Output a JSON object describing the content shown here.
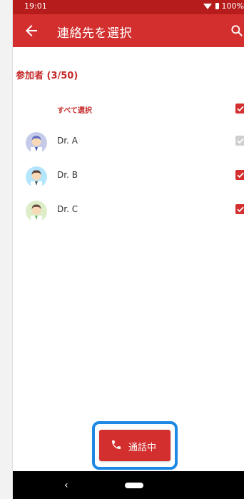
{
  "status_bar": {
    "time": "19:01",
    "battery_text": "100%"
  },
  "app_bar": {
    "title": "連絡先を選択",
    "back_icon": "arrow-back-icon",
    "search_icon": "search-icon"
  },
  "participants": {
    "header": "参加者 (3/50)",
    "select_all_label": "すべて選択",
    "select_all_checked": true,
    "items": [
      {
        "name": "Dr. A",
        "avatar_icon": "doctor-avatar-icon",
        "checked": true,
        "disabled": true
      },
      {
        "name": "Dr. B",
        "avatar_icon": "doctor-avatar-icon",
        "checked": true,
        "disabled": false
      },
      {
        "name": "Dr. C",
        "avatar_icon": "doctor-avatar-icon",
        "checked": true,
        "disabled": false
      }
    ]
  },
  "call_button": {
    "label": "通話中",
    "icon": "phone-icon"
  },
  "colors": {
    "primary": "#d32f2f",
    "status_bar": "#b71c1c",
    "focus_ring": "#1e88e5"
  },
  "nav_bar": {
    "back": "‹"
  }
}
